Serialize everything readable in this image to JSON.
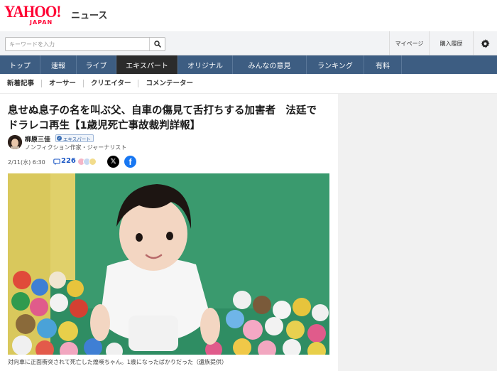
{
  "header": {
    "logo_main": "YAHOO!",
    "logo_sub": "JAPAN",
    "logo_news": "ニュース"
  },
  "search": {
    "placeholder": "キーワードを入力",
    "value": ""
  },
  "utility": {
    "mypage": "マイページ",
    "history": "購入履歴",
    "settings_icon": "gear-icon"
  },
  "global_nav": [
    {
      "label": "トップ"
    },
    {
      "label": "速報"
    },
    {
      "label": "ライブ"
    },
    {
      "label": "エキスパート",
      "active": true
    },
    {
      "label": "オリジナル"
    },
    {
      "label": "みんなの意見"
    },
    {
      "label": "ランキング"
    },
    {
      "label": "有料"
    }
  ],
  "sub_nav": [
    {
      "label": "新着記事"
    },
    {
      "label": "オーサー"
    },
    {
      "label": "クリエイター"
    },
    {
      "label": "コメンテーター"
    }
  ],
  "article": {
    "title_line1": "息せぬ息子の名を叫ぶ父、自車の傷見て舌打ちする加害者　法廷で",
    "title_line2": "ドラレコ再生【1歳児死亡事故裁判詳報】",
    "author_name": "柳原三佳",
    "author_badge": "エキスパート",
    "author_desc": "ノンフィクション作家・ジャーナリスト",
    "date": "2/11(水) 6:30",
    "comment_count": "226",
    "photo_caption": "対向車に正面衝突されて死亡した煌暎ちゃん。1歳になったばかりだった（遺族提供）"
  },
  "colors": {
    "brand_red": "#ff0033",
    "nav_blue": "#3d5d82",
    "nav_active": "#2b2b2b",
    "link_blue": "#1a56c4",
    "x_black": "#000000",
    "facebook_blue": "#1877f2"
  }
}
